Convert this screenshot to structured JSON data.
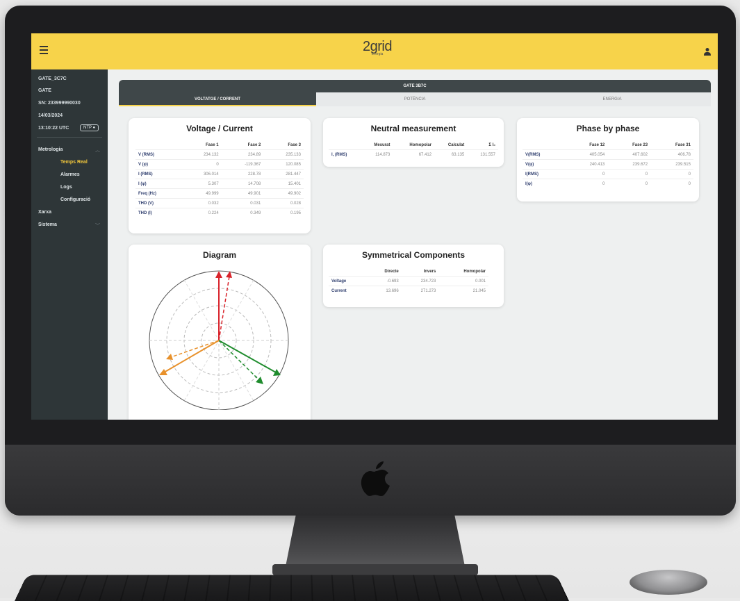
{
  "app": {
    "brand": "2grid",
    "brand_sub": "energia"
  },
  "sidebar": {
    "device_name": "GATE_3C7C",
    "device_type": "GATE",
    "serial": "SN: 233999990030",
    "date": "14/03/2024",
    "time": "13:10:22 UTC",
    "ntp_badge": "NTP ●",
    "nav": [
      {
        "label": "Metrologia",
        "expandable": true
      },
      {
        "label": "Temps Real",
        "active": true
      },
      {
        "label": "Alarmes"
      },
      {
        "label": "Logs"
      },
      {
        "label": "Configuració"
      },
      {
        "label": "Xarxa"
      },
      {
        "label": "Sistema",
        "expandable": true
      }
    ]
  },
  "gate_header": "GATE 3B7C",
  "tabs": [
    "VOLTATGE / CORRENT",
    "POTÈNCIA",
    "ENERGIA"
  ],
  "voltage_current": {
    "title": "Voltage / Current",
    "headers": [
      "",
      "Fase 1",
      "Fase 2",
      "Fase 3"
    ],
    "rows": [
      [
        "V (RMS)",
        "234.132",
        "234.89",
        "235.133"
      ],
      [
        "V (φ)",
        "0",
        "-119.367",
        "120.085"
      ],
      [
        "I (RMS)",
        "306.014",
        "228.78",
        "281.447"
      ],
      [
        "I (φ)",
        "5.307",
        "14.708",
        "15.401"
      ],
      [
        "Freq (Hz)",
        "49.999",
        "49.901",
        "49.902"
      ],
      [
        "THD (V)",
        "0.032",
        "0.031",
        "0.028"
      ],
      [
        "THD (I)",
        "0.224",
        "0.349",
        "0.195"
      ]
    ]
  },
  "neutral": {
    "title": "Neutral measurement",
    "headers": [
      "",
      "Mesurat",
      "Homopolar",
      "Calculat",
      "Σ I₀"
    ],
    "rows": [
      [
        "I, (RMS)",
        "114.873",
        "67.412",
        "63.135",
        "131.557"
      ]
    ]
  },
  "phase_by_phase": {
    "title": "Phase by phase",
    "headers": [
      "",
      "Fase 12",
      "Fase 23",
      "Fase 31"
    ],
    "rows": [
      [
        "V(RMS)",
        "405.054",
        "407.602",
        "406.78"
      ],
      [
        "V(φ)",
        "240.413",
        "239.672",
        "239.515"
      ],
      [
        "I(RMS)",
        "0",
        "0",
        "0"
      ],
      [
        "I(φ)",
        "0",
        "0",
        "0"
      ]
    ]
  },
  "diagram": {
    "title": "Diagram"
  },
  "symmetrical": {
    "title": "Symmetrical Components",
    "headers": [
      "",
      "Directe",
      "Invers",
      "Homopolar"
    ],
    "rows": [
      [
        "Voltage",
        "-0.693",
        "234.723",
        "0.001"
      ],
      [
        "Current",
        "13.696",
        "271.273",
        "21.045"
      ]
    ]
  },
  "colors": {
    "accent": "#f7d34a",
    "sidebar": "#2e3638",
    "phase1": "#d9232b",
    "phase2": "#1f8c2d",
    "phase3": "#e8912b"
  }
}
